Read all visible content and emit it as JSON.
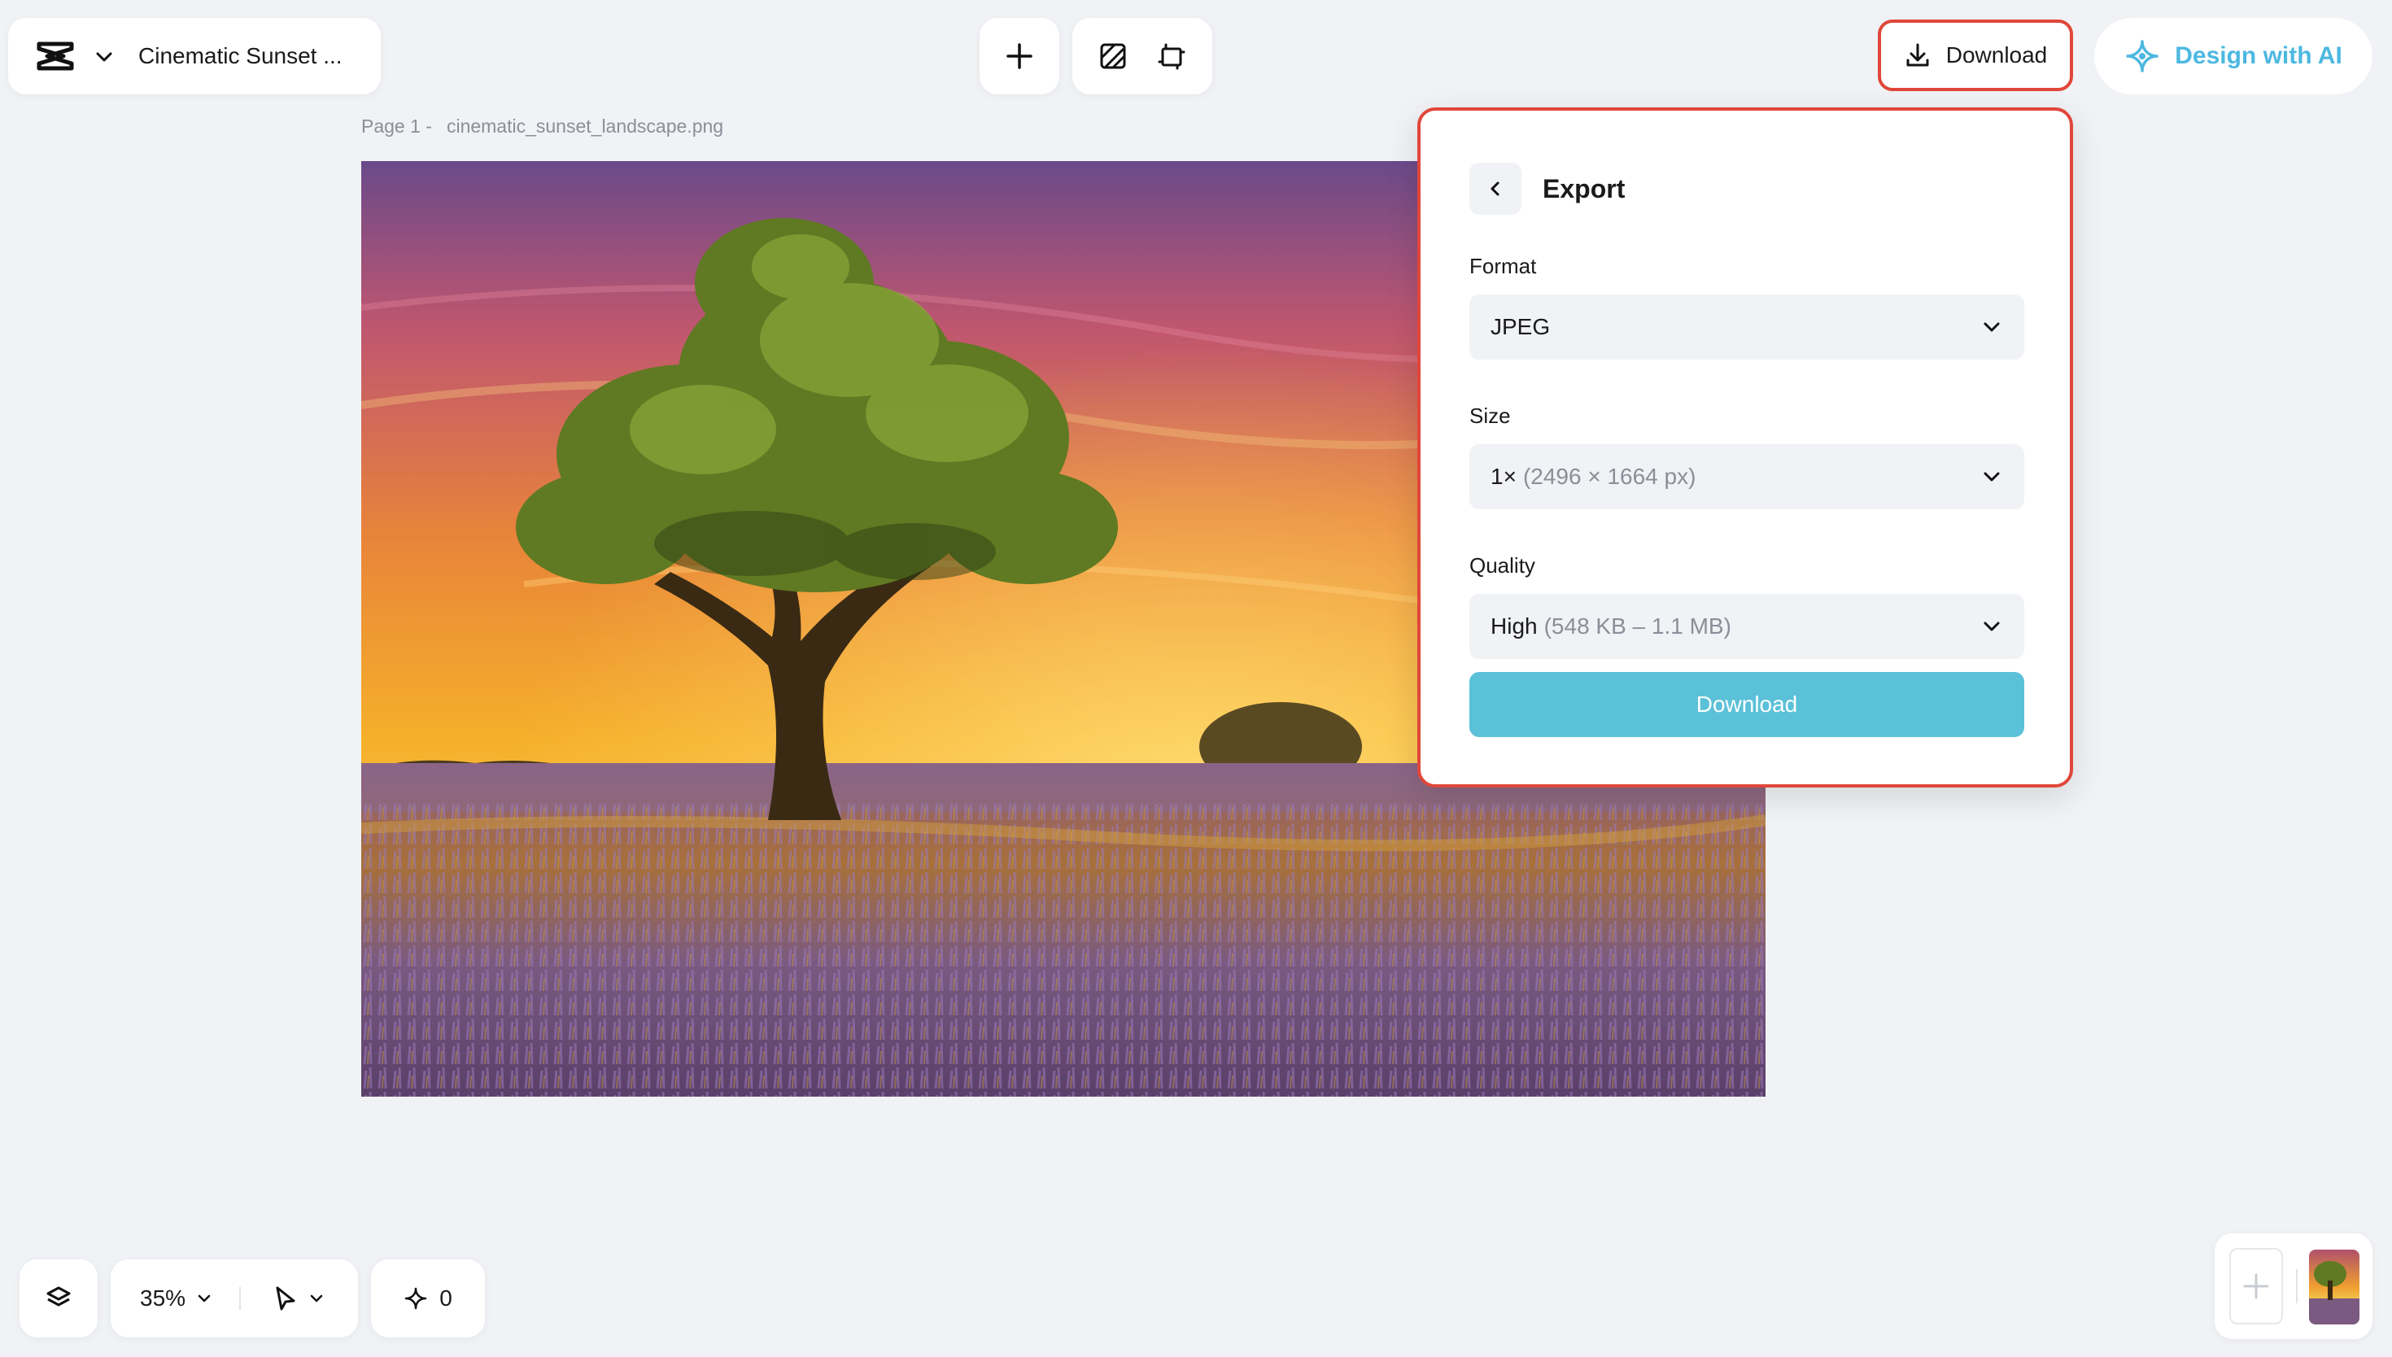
{
  "header": {
    "project_title": "Cinematic Sunset ...",
    "download_label": "Download",
    "design_ai_label": "Design with AI"
  },
  "page_label": {
    "page": "Page 1 -",
    "file_name": "cinematic_sunset_landscape.png"
  },
  "export_panel": {
    "title": "Export",
    "format_label": "Format",
    "format_value": "JPEG",
    "size_label": "Size",
    "size_value": "1×",
    "size_detail": "(2496 × 1664 px)",
    "quality_label": "Quality",
    "quality_value": "High",
    "quality_detail": "(548 KB – 1.1 MB)",
    "download_label": "Download"
  },
  "bottom_bar": {
    "zoom": "35%",
    "ai_credits": "0"
  },
  "colors": {
    "accent_red": "#e0473a",
    "ai_blue": "#4db8e0",
    "download_teal": "#5bc1d8",
    "background": "#f0f2f5"
  }
}
